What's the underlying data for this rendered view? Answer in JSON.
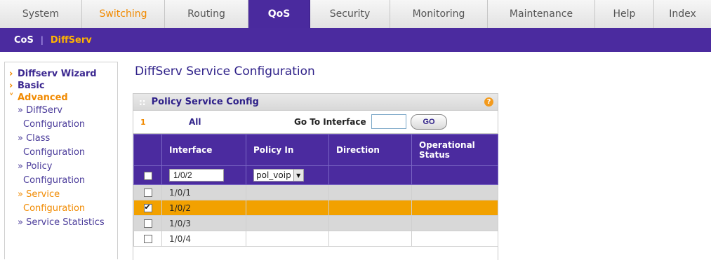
{
  "topnav": {
    "tabs": [
      {
        "label": "System",
        "style": "normal",
        "width": 117
      },
      {
        "label": "Switching",
        "style": "orange",
        "width": 118
      },
      {
        "label": "Routing",
        "style": "normal",
        "width": 119
      },
      {
        "label": "QoS",
        "style": "active",
        "width": 88
      },
      {
        "label": "Security",
        "style": "normal",
        "width": 114
      },
      {
        "label": "Monitoring",
        "style": "normal",
        "width": 139
      },
      {
        "label": "Maintenance",
        "style": "normal",
        "width": 153
      },
      {
        "label": "Help",
        "style": "normal",
        "width": 84
      },
      {
        "label": "Index",
        "style": "normal",
        "width": 81
      }
    ]
  },
  "subnav": {
    "items": [
      "CoS",
      "DiffServ"
    ],
    "current": "DiffServ"
  },
  "leftmenu": {
    "diffserv_wizard": "Diffserv Wizard",
    "basic": "Basic",
    "advanced": "Advanced",
    "sub": [
      {
        "line1": "» DiffServ",
        "line2": "Configuration"
      },
      {
        "line1": "» Class",
        "line2": "Configuration"
      },
      {
        "line1": "» Policy",
        "line2": "Configuration"
      },
      {
        "line1": "» Service",
        "line2": "Configuration"
      },
      {
        "line1": "» Service Statistics",
        "line2": ""
      }
    ]
  },
  "page_title": "DiffServ Service Configuration",
  "panel": {
    "title": "Policy Service Config",
    "help_icon": "?",
    "pager": {
      "page": "1",
      "all": "All",
      "goto_label": "Go To Interface",
      "goto_value": "",
      "go_button": "GO"
    },
    "columns": [
      "Interface",
      "Policy In",
      "Direction",
      "Operational Status"
    ],
    "edit_row": {
      "interface_value": "1/0/2",
      "policy_in_value": "pol_voip"
    },
    "rows": [
      {
        "interface": "1/0/1",
        "checked": false,
        "style": "gray"
      },
      {
        "interface": "1/0/2",
        "checked": true,
        "style": "sel"
      },
      {
        "interface": "1/0/3",
        "checked": false,
        "style": "gray"
      },
      {
        "interface": "1/0/4",
        "checked": false,
        "style": "white"
      }
    ]
  },
  "colors": {
    "brand_purple": "#4b2b9f",
    "accent_orange": "#f18a00",
    "selected_row": "#f2a100"
  }
}
